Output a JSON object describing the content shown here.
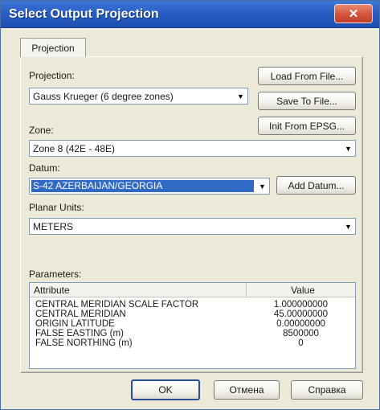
{
  "window": {
    "title": "Select Output Projection",
    "close_label": "✕"
  },
  "tabs": [
    {
      "label": "Projection"
    }
  ],
  "projection": {
    "label": "Projection:",
    "value": "Gauss Krueger (6 degree zones)"
  },
  "zone": {
    "label": "Zone:",
    "value": "Zone 8 (42E - 48E)"
  },
  "datum": {
    "label": "Datum:",
    "value": "S-42 AZERBAIJAN/GEORGIA"
  },
  "planar_units": {
    "label": "Planar Units:",
    "value": "METERS"
  },
  "buttons": {
    "load_from_file": "Load From File...",
    "save_to_file": "Save To File...",
    "init_from_epsg": "Init From EPSG...",
    "add_datum": "Add Datum...",
    "ok": "OK",
    "cancel": "Отмена",
    "help": "Справка"
  },
  "parameters": {
    "label": "Parameters:",
    "columns": [
      "Attribute",
      "Value"
    ],
    "rows": [
      {
        "attribute": "CENTRAL MERIDIAN SCALE FACTOR",
        "value": "1.000000000"
      },
      {
        "attribute": "CENTRAL MERIDIAN",
        "value": "45.00000000"
      },
      {
        "attribute": "ORIGIN LATITUDE",
        "value": "0.00000000"
      },
      {
        "attribute": "FALSE EASTING (m)",
        "value": "8500000"
      },
      {
        "attribute": "FALSE NORTHING (m)",
        "value": "0"
      }
    ]
  }
}
